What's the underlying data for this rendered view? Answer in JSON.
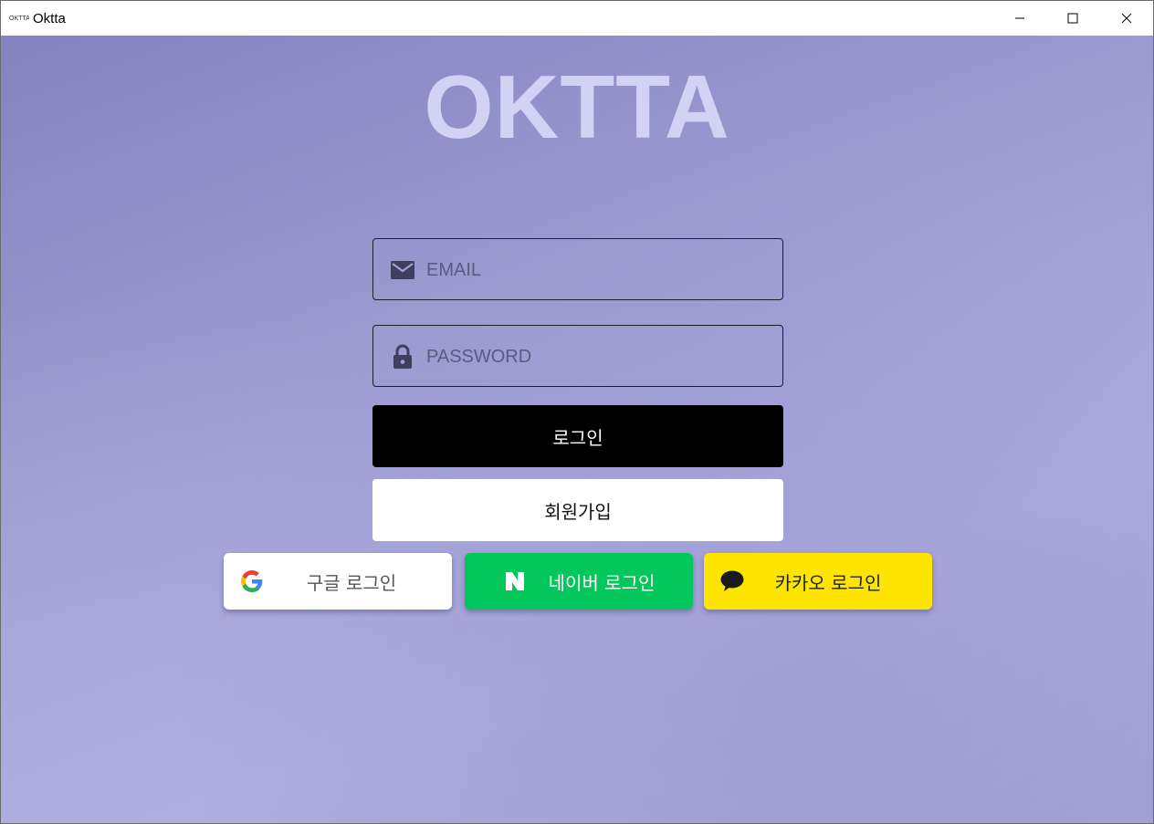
{
  "window": {
    "title": "Oktta",
    "app_icon": "oktta-mini-logo",
    "controls": [
      "minimize-icon",
      "maximize-icon",
      "close-icon"
    ]
  },
  "brand": {
    "logo_text": "OKTTA"
  },
  "login_form": {
    "email": {
      "placeholder": "EMAIL",
      "value": "",
      "icon": "mail-icon"
    },
    "password": {
      "placeholder": "PASSWORD",
      "value": "",
      "icon": "lock-icon"
    },
    "login_label": "로그인",
    "signup_label": "회원가입"
  },
  "social_login": {
    "google": {
      "label": "구글 로그인",
      "icon": "google-icon"
    },
    "naver": {
      "label": "네이버 로그인",
      "icon": "naver-icon"
    },
    "kakao": {
      "label": "카카오 로그인",
      "icon": "kakao-talk-icon"
    }
  },
  "colors": {
    "background_start": "#8583c0",
    "background_end": "#aeade0",
    "logo": "#d3d2f4",
    "login_button": "#000000",
    "naver": "#03c75a",
    "kakao": "#fee500"
  }
}
